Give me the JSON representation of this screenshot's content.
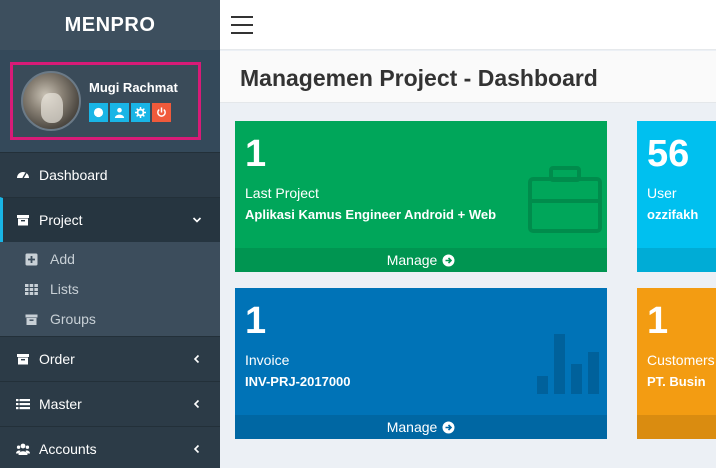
{
  "brand": "MENPRO",
  "user": {
    "name": "Mugi Rachmat",
    "actions": [
      "circle-icon",
      "user-icon",
      "gear-icon",
      "power-icon"
    ]
  },
  "sidebar": {
    "items": [
      {
        "label": "Dashboard",
        "icon": "dashboard-icon"
      },
      {
        "label": "Project",
        "icon": "archive-icon",
        "expanded": true
      },
      {
        "label": "Order",
        "icon": "archive-icon"
      },
      {
        "label": "Master",
        "icon": "list-icon"
      },
      {
        "label": "Accounts",
        "icon": "users-icon"
      }
    ],
    "submenu": [
      {
        "label": "Add",
        "icon": "plus-square-icon"
      },
      {
        "label": "Lists",
        "icon": "grid-icon"
      },
      {
        "label": "Groups",
        "icon": "archive-icon"
      }
    ]
  },
  "header": {
    "menu_icon": "hamburger-icon"
  },
  "page": {
    "title": "Managemen Project - Dashboard"
  },
  "boxes": [
    {
      "count": "1",
      "label": "Last Project",
      "value": "Aplikasi Kamus Engineer Android + Web",
      "footer": "Manage",
      "color": "#00a65a",
      "icon": "briefcase-icon"
    },
    {
      "count": "56",
      "label": "User",
      "value": "ozzifakh",
      "color": "#00c0ef"
    },
    {
      "count": "1",
      "label": "Invoice",
      "value": "INV-PRJ-2017000",
      "footer": "Manage",
      "color": "#0073b7",
      "icon": "bar-chart-icon"
    },
    {
      "count": "1",
      "label": "Customers",
      "value": "PT. Busin",
      "color": "#f39c12"
    }
  ]
}
